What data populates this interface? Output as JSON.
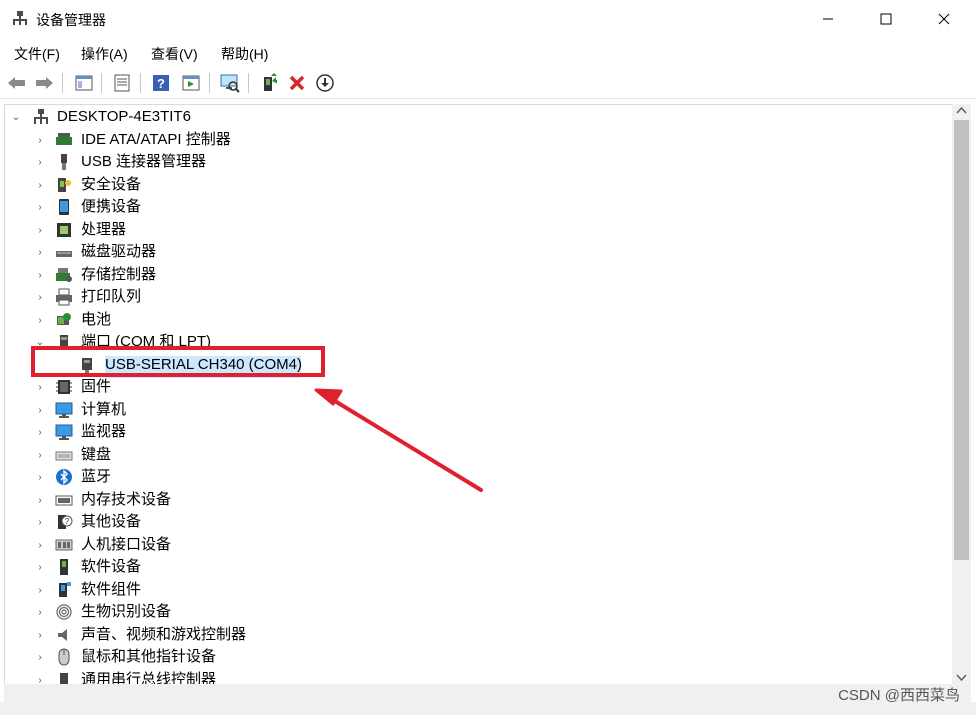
{
  "window": {
    "title": "设备管理器",
    "controls": [
      "minimize",
      "maximize",
      "close"
    ]
  },
  "menu": {
    "items": [
      {
        "label": "文件(F)"
      },
      {
        "label": "操作(A)"
      },
      {
        "label": "查看(V)"
      },
      {
        "label": "帮助(H)"
      }
    ]
  },
  "toolbar": {
    "buttons": [
      "back-icon",
      "forward-icon",
      "show-hide-console-tree-icon",
      "properties-icon",
      "help-icon",
      "action-pane-icon",
      "scan-hardware-icon",
      "update-driver-icon",
      "uninstall-icon",
      "download-icon"
    ]
  },
  "tree": {
    "root": "DESKTOP-4E3TIT6",
    "categories": [
      {
        "label": "IDE ATA/ATAPI 控制器",
        "expanded": false
      },
      {
        "label": "USB 连接器管理器",
        "expanded": false
      },
      {
        "label": "安全设备",
        "expanded": false
      },
      {
        "label": "便携设备",
        "expanded": false
      },
      {
        "label": "处理器",
        "expanded": false
      },
      {
        "label": "磁盘驱动器",
        "expanded": false
      },
      {
        "label": "存储控制器",
        "expanded": false
      },
      {
        "label": "打印队列",
        "expanded": false
      },
      {
        "label": "电池",
        "expanded": false
      },
      {
        "label": "端口 (COM 和 LPT)",
        "expanded": true
      },
      {
        "label": "固件",
        "expanded": false
      },
      {
        "label": "计算机",
        "expanded": false
      },
      {
        "label": "监视器",
        "expanded": false
      },
      {
        "label": "键盘",
        "expanded": false
      },
      {
        "label": "蓝牙",
        "expanded": false
      },
      {
        "label": "内存技术设备",
        "expanded": false
      },
      {
        "label": "其他设备",
        "expanded": false
      },
      {
        "label": "人机接口设备",
        "expanded": false
      },
      {
        "label": "软件设备",
        "expanded": false
      },
      {
        "label": "软件组件",
        "expanded": false
      },
      {
        "label": "生物识别设备",
        "expanded": false
      },
      {
        "label": "声音、视频和游戏控制器",
        "expanded": false
      },
      {
        "label": "鼠标和其他指针设备",
        "expanded": false
      },
      {
        "label": "通用串行总线控制器",
        "expanded": false
      }
    ],
    "port_child": "USB-SERIAL CH340 (COM4)"
  },
  "annotation": {
    "color": "#e0202e"
  },
  "watermark": "CSDN @西西菜鸟"
}
